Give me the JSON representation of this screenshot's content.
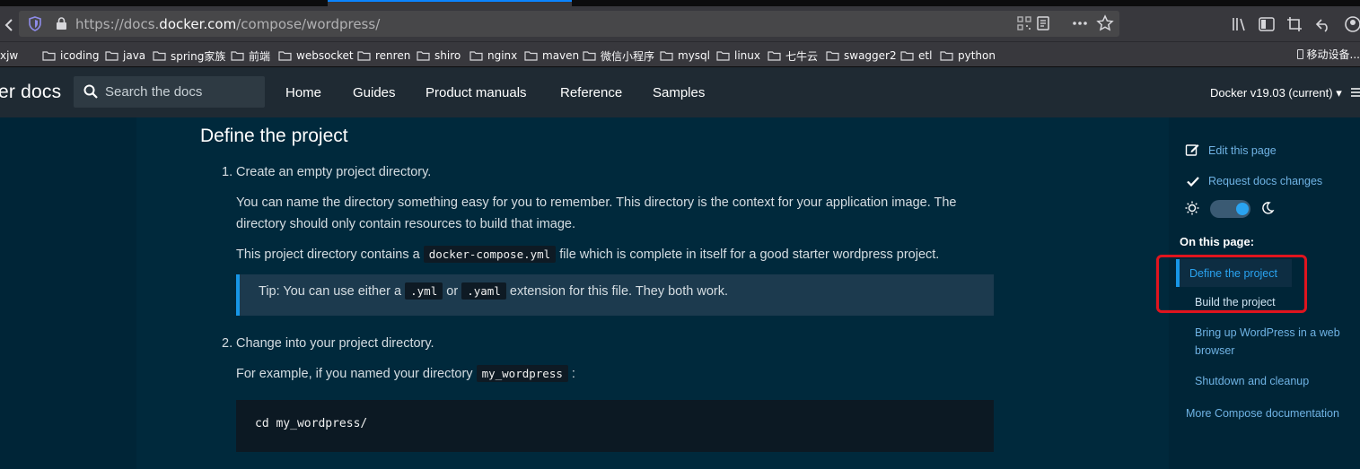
{
  "browser": {
    "url_prefix": "https://docs.",
    "url_domain": "docker.com",
    "url_path": "/compose/wordpress/"
  },
  "bookmarks": {
    "items": [
      "xjw",
      "icoding",
      "java",
      "spring家族",
      "前端",
      "websocket",
      "renren",
      "shiro",
      "nginx",
      "maven",
      "微信小程序",
      "mysql",
      "linux",
      "七牛云",
      "swagger2",
      "etl",
      "python"
    ],
    "right_label": "移动设备..."
  },
  "header": {
    "logo": "er docs",
    "search_placeholder": "Search the docs",
    "nav": [
      "Home",
      "Guides",
      "Product manuals",
      "Reference",
      "Samples"
    ],
    "version": "Docker v19.03 (current)"
  },
  "content": {
    "title": "Define the project",
    "step1_num": "1.",
    "step1": "Create an empty project directory.",
    "p1_line1": "You can name the directory something easy for you to remember. This directory is the context for your application image. The",
    "p1_line2": "directory should only contain resources to build that image.",
    "p2_before": "This project directory contains a",
    "p2_code": "docker-compose.yml",
    "p2_after": "file which is complete in itself for a good starter wordpress project.",
    "tip_label": "Tip",
    "tip_before": ": You can use either a",
    "tip_code1": ".yml",
    "tip_or": "or",
    "tip_code2": ".yaml",
    "tip_after": "extension for this file. They both work.",
    "step2_num": "2.",
    "step2": "Change into your project directory.",
    "p3_before": "For example, if you named your directory",
    "p3_code": "my_wordpress",
    "p3_after": ":",
    "codeblock": "cd my_wordpress/"
  },
  "sidebar": {
    "edit": "Edit this page",
    "request": "Request docs changes",
    "on_this_page": "On this page:",
    "toc": [
      "Define the project",
      "Build the project",
      "Bring up WordPress in a web",
      "browser",
      "Shutdown and cleanup"
    ],
    "more": "More Compose documentation",
    "theme_toggle_dark": true
  },
  "colors": {
    "accent": "#1796e6",
    "highlight_box": "#e0141e",
    "link": "#6fb3e4"
  }
}
